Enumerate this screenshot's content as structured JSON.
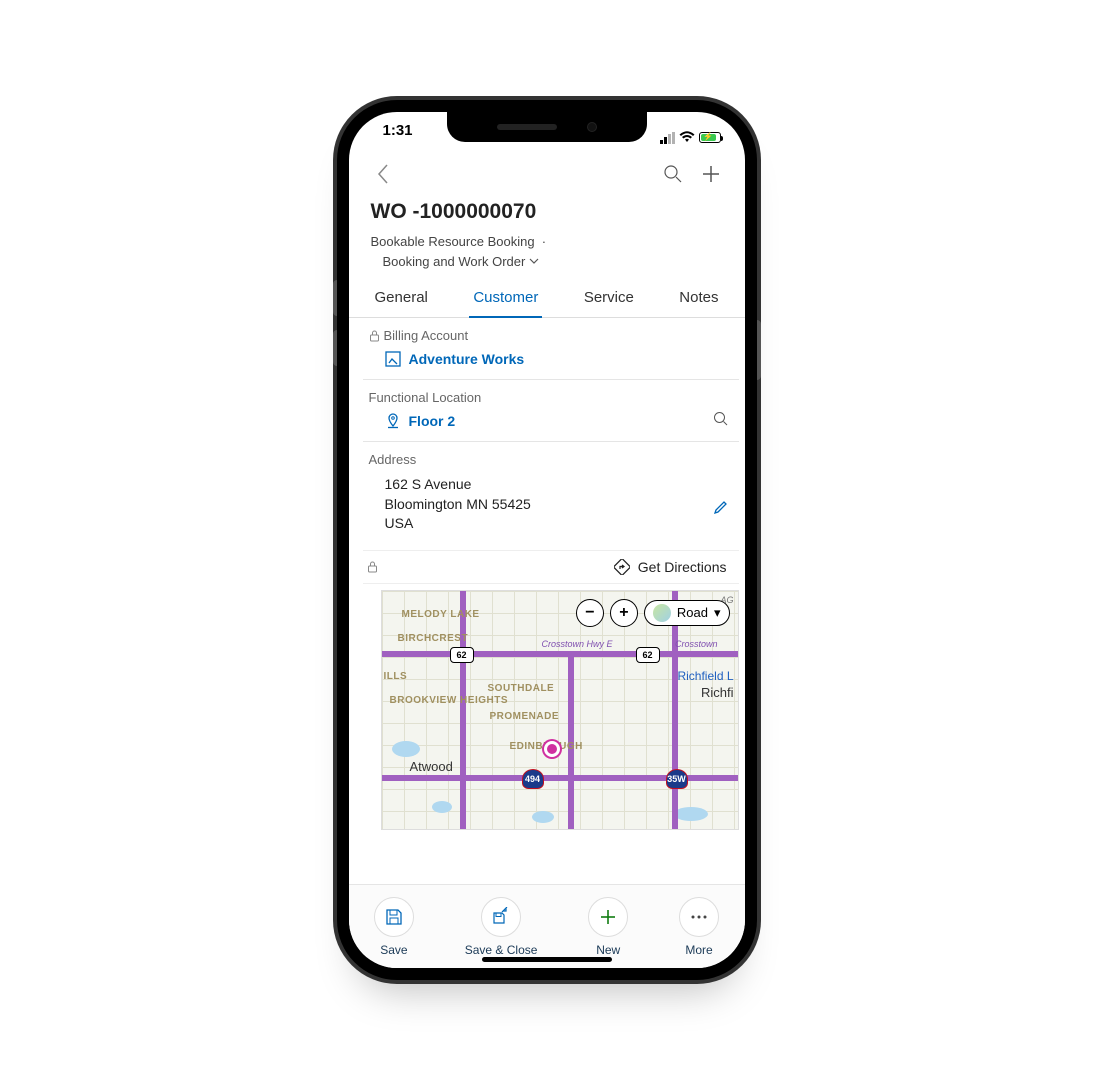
{
  "statusbar": {
    "time": "1:31"
  },
  "header": {
    "title": "WO -1000000070",
    "breadcrumb1": "Bookable Resource Booking",
    "separator": "·",
    "form_selector": "Booking and Work Order"
  },
  "tabs": {
    "items": [
      {
        "label": "General",
        "active": false
      },
      {
        "label": "Customer",
        "active": true
      },
      {
        "label": "Service",
        "active": false
      },
      {
        "label": "Notes",
        "active": false
      }
    ]
  },
  "fields": {
    "billing_account": {
      "label": "Billing Account",
      "value": "Adventure Works"
    },
    "functional_location": {
      "label": "Functional Location",
      "value": "Floor 2"
    },
    "address": {
      "label": "Address",
      "line1": "162 S Avenue",
      "line2": "Bloomington MN 55425",
      "line3": "USA"
    }
  },
  "map": {
    "get_directions": "Get Directions",
    "view_mode": "Road",
    "towns": {
      "melody": "MELODY LAKE",
      "birchcrest": "BIRCHCREST",
      "ills": "ILLS",
      "brookview": "BROOKVIEW HEIGHTS",
      "southdale": "SOUTHDALE",
      "promenade": "PROMENADE",
      "edin": "EDINBROUGH",
      "atwood": "Atwood",
      "richfield": "Richfield L",
      "richfi": "Richfi"
    },
    "hwy": {
      "h62a": "62",
      "h62b": "62",
      "ct": "Crosstown Hwy E",
      "ct2": "Crosstown",
      "ag": "AG",
      "i494": "494",
      "i35w": "35W"
    }
  },
  "commandbar": {
    "save": "Save",
    "saveclose": "Save & Close",
    "new": "New",
    "more": "More"
  }
}
